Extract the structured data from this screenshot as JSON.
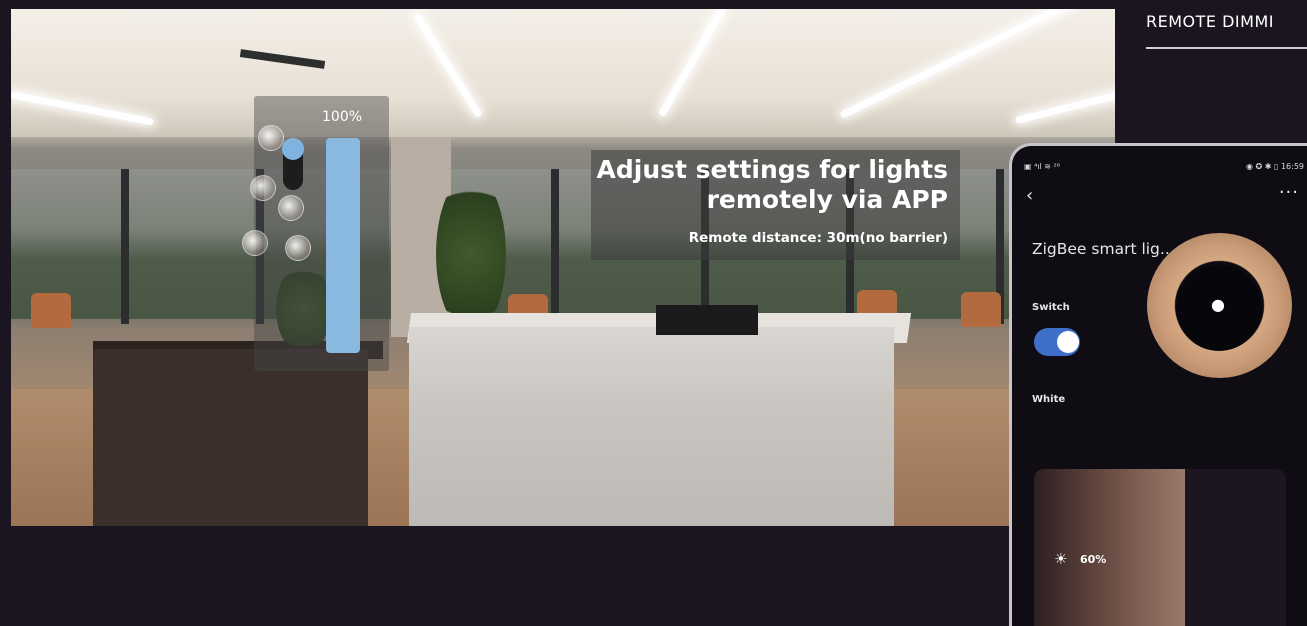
{
  "brightness_overlay": {
    "label": "100%",
    "level_percent": 100
  },
  "headline": {
    "line1": "Adjust settings for lights",
    "line2": "remotely via APP",
    "sub": "Remote distance: 30m(no barrier)"
  },
  "section": {
    "title": "REMOTE DIMMI"
  },
  "phone": {
    "status_left": "▣ ⁴ıl ≋ ²⁶",
    "status_right": "◉ ✪ ✱ ▯ 16:59",
    "back_glyph": "‹",
    "more_glyph": "···",
    "device_name": "ZigBee smart lig...",
    "switch_label": "Switch",
    "switch_on": true,
    "white_label": "White",
    "brightness_icon": "sun-icon",
    "brightness_glyph": "☀",
    "brightness_value": "60%",
    "brightness_fraction": 0.6,
    "bulb_glyph": "●",
    "accent": "#3f6fc9"
  }
}
